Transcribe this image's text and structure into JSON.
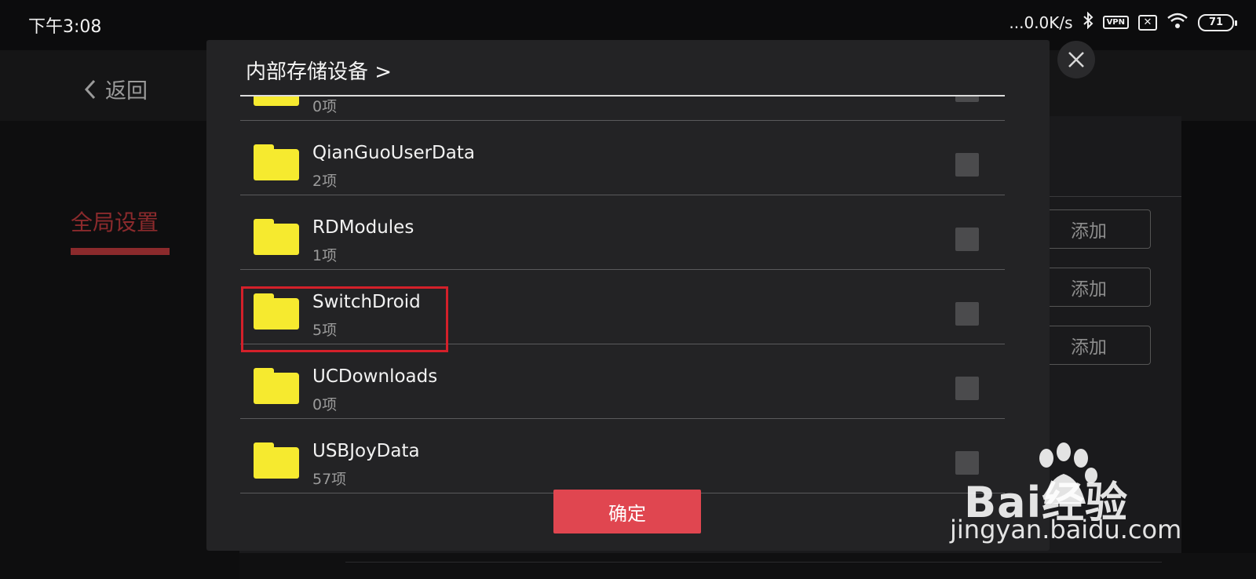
{
  "status_bar": {
    "time": "下午3:08",
    "network_speed": "...0.0K/s",
    "vpn_label": "VPN",
    "battery": "71"
  },
  "background": {
    "back_label": "返回",
    "sidebar_active": "全局设置",
    "add_buttons": [
      "添加",
      "添加",
      "添加"
    ]
  },
  "dialog": {
    "title": "内部存储设备 >",
    "items": [
      {
        "name": "",
        "count": "0项"
      },
      {
        "name": "QianGuoUserData",
        "count": "2项"
      },
      {
        "name": "RDModules",
        "count": "1项"
      },
      {
        "name": "SwitchDroid",
        "count": "5项"
      },
      {
        "name": "UCDownloads",
        "count": "0项"
      },
      {
        "name": "USBJoyData",
        "count": "57项"
      }
    ],
    "confirm_label": "确定"
  },
  "watermark": {
    "text": "Bai经验",
    "url": "jingyan.baidu.com"
  },
  "colors": {
    "accent_red": "#e04650",
    "folder_yellow": "#f6ea2f",
    "highlight_red": "#d4202a"
  }
}
